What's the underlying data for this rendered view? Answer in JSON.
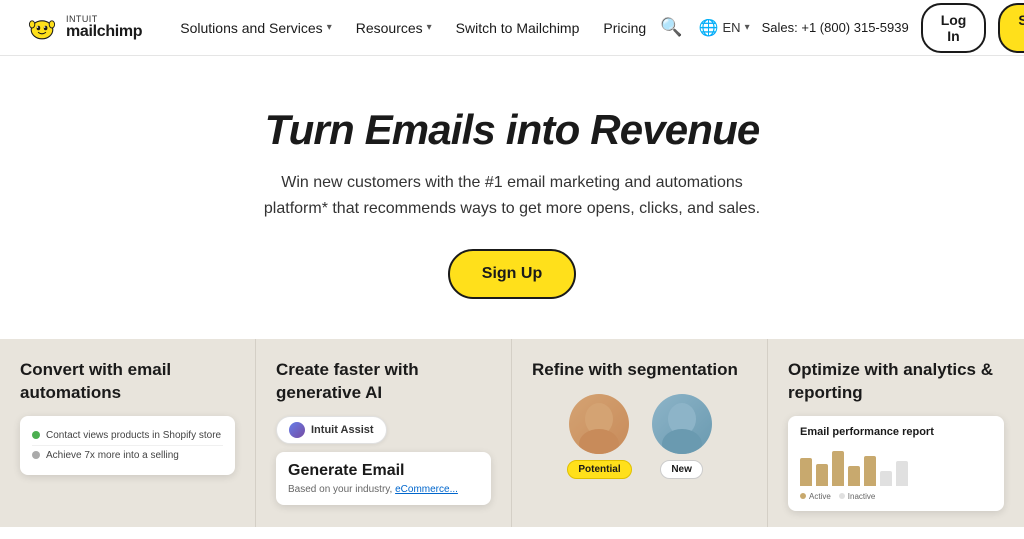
{
  "navbar": {
    "logo_intuit": "INTUIT",
    "logo_mailchimp": "mailchimp",
    "nav_items": [
      {
        "label": "Solutions and Services",
        "has_chevron": true
      },
      {
        "label": "Resources",
        "has_chevron": true
      },
      {
        "label": "Switch to Mailchimp",
        "has_chevron": false
      },
      {
        "label": "Pricing",
        "has_chevron": false
      }
    ],
    "sales_phone": "Sales: +1 (800) 315-5939",
    "lang": "EN",
    "login_label": "Log In",
    "signup_label": "Sign Up"
  },
  "hero": {
    "title": "Turn Emails into Revenue",
    "subtitle": "Win new customers with the #1 email marketing and automations platform* that recommends ways to get more opens, clicks, and sales.",
    "cta_label": "Sign Up"
  },
  "features": [
    {
      "id": "email-automations",
      "title": "Convert with email automations",
      "mockup_rows": [
        {
          "text": "Contact views products in Shopify store"
        },
        {
          "text": "Achieve 7x more into a selling"
        }
      ]
    },
    {
      "id": "generative-ai",
      "title": "Create faster with generative AI",
      "ai_label": "Intuit Assist",
      "ai_card_title": "Generate Email",
      "ai_card_sub": "Based on your industry, ",
      "ai_card_link": "eCommerce..."
    },
    {
      "id": "segmentation",
      "title": "Refine with segmentation",
      "badge_potential": "Potential",
      "badge_new": "New"
    },
    {
      "id": "analytics",
      "title": "Optimize with analytics & reporting",
      "report_title": "Email performance report",
      "legend": [
        {
          "label": "Active",
          "color": "#c8a96e"
        },
        {
          "label": "Inactive",
          "color": "#e0e0e0"
        }
      ],
      "bars": [
        28,
        22,
        35,
        20,
        30,
        15,
        25
      ]
    }
  ],
  "colors": {
    "accent_yellow": "#ffe01b",
    "bg_features": "#e8e4dc",
    "nav_border": "#e5e5e5"
  }
}
